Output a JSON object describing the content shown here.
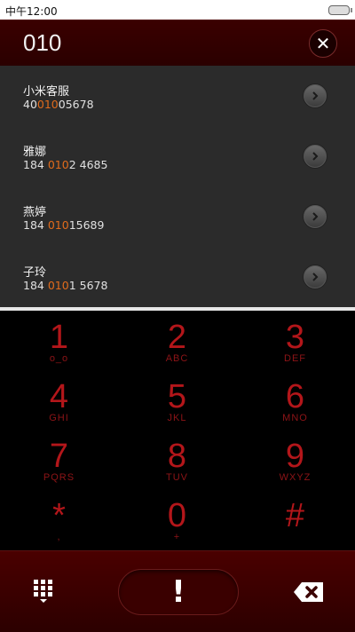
{
  "status_bar": {
    "time": "中午12:00"
  },
  "header": {
    "dialed_number": "010"
  },
  "contacts": [
    {
      "name": "小米客服",
      "phone_prefix": "40",
      "phone_match": "010",
      "phone_suffix": "05678"
    },
    {
      "name": "雅娜",
      "phone_prefix": "184 ",
      "phone_match": "010",
      "phone_suffix": "2 4685"
    },
    {
      "name": "燕婷",
      "phone_prefix": "184 ",
      "phone_match": "010",
      "phone_suffix": "15689"
    },
    {
      "name": "子玲",
      "phone_prefix": "184 ",
      "phone_match": "010",
      "phone_suffix": "1 5678"
    }
  ],
  "keypad": [
    {
      "digit": "1",
      "letters": "o_o"
    },
    {
      "digit": "2",
      "letters": "ABC"
    },
    {
      "digit": "3",
      "letters": "DEF"
    },
    {
      "digit": "4",
      "letters": "GHI"
    },
    {
      "digit": "5",
      "letters": "JKL"
    },
    {
      "digit": "6",
      "letters": "MNO"
    },
    {
      "digit": "7",
      "letters": "PQRS"
    },
    {
      "digit": "8",
      "letters": "TUV"
    },
    {
      "digit": "9",
      "letters": "WXYZ"
    },
    {
      "digit": "*",
      "letters": ","
    },
    {
      "digit": "0",
      "letters": "+"
    },
    {
      "digit": "#",
      "letters": ""
    }
  ],
  "bottom_bar": {
    "call_label": "!"
  },
  "colors": {
    "accent_red": "#b3161a",
    "match_orange": "#e06b1c",
    "header_bg": "#3a0000"
  },
  "icons": {
    "clear": "close-icon",
    "contact_action": "chevron-right-icon",
    "dialpad": "dialpad-grid-icon",
    "backspace": "backspace-icon"
  }
}
